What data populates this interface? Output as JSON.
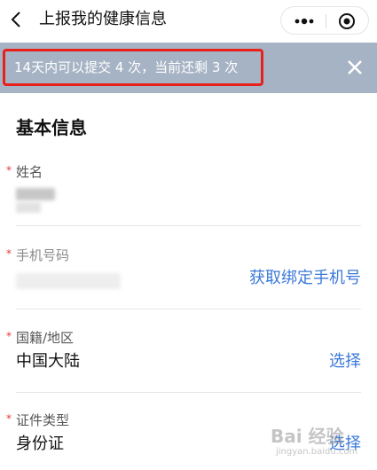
{
  "header": {
    "title": "上报我的健康信息",
    "back_icon": "chevron-left-icon",
    "more_icon": "more-dots-icon",
    "close_icon": "target-circle-icon"
  },
  "notice": {
    "text": "14天内可以提交 4 次，当前还剩 3 次",
    "highlight_color": "#e8201c",
    "background_color": "#a6b3c4"
  },
  "section": {
    "title": "基本信息"
  },
  "fields": [
    {
      "label": "姓名",
      "required": "*",
      "value": ""
    },
    {
      "label": "手机号码",
      "required": "*",
      "value": "",
      "action": "获取绑定手机号"
    },
    {
      "label": "国籍/地区",
      "required": "*",
      "value": "中国大陆",
      "action": "选择"
    },
    {
      "label": "证件类型",
      "required": "*",
      "value": "身份证",
      "action": "选择"
    }
  ],
  "accent_color": "#3b79d8",
  "watermark": {
    "main": "Bai 经验",
    "sub": "jingyan.baidu.com"
  }
}
